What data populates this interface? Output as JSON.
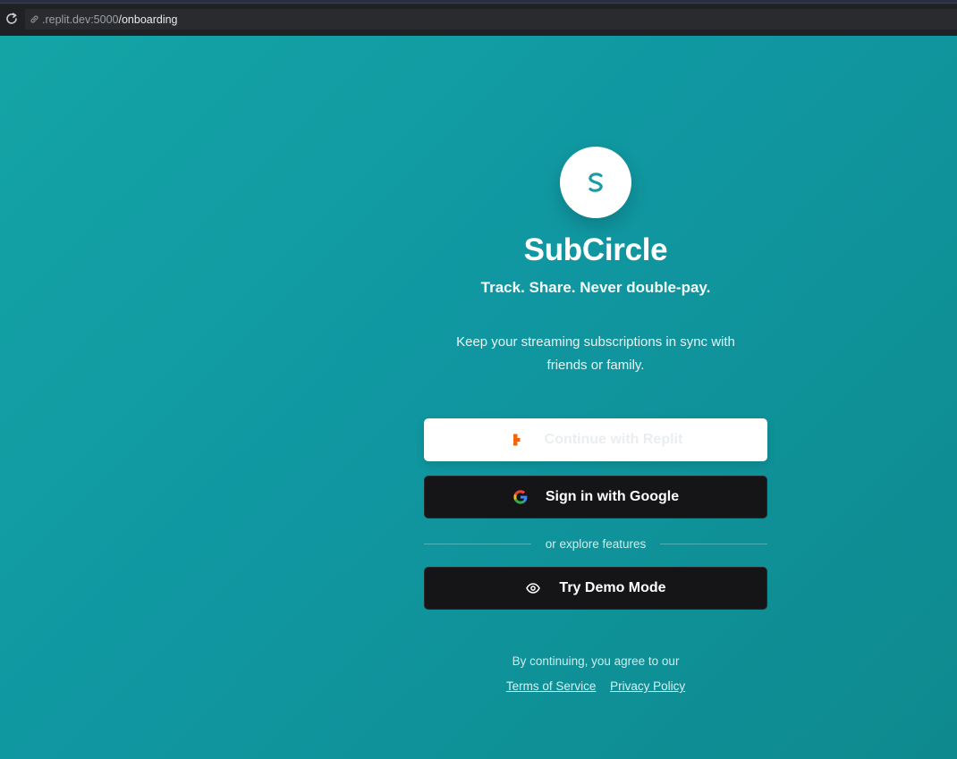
{
  "browser": {
    "url_host": ".replit.dev:5000",
    "url_path": "/onboarding",
    "icons": {
      "reload": "reload-icon",
      "link": "link-icon"
    }
  },
  "app": {
    "name": "SubCircle",
    "logo_letter": "S",
    "tagline": "Track. Share. Never double-pay.",
    "description": "Keep your streaming subscriptions in sync with friends or family."
  },
  "auth": {
    "replit_label": "Continue with Replit",
    "google_label": "Sign in with Google",
    "divider_text": "or explore features",
    "demo_label": "Try Demo Mode"
  },
  "legal": {
    "agree_text": "By continuing, you agree to our",
    "terms_label": "Terms of Service",
    "privacy_label": "Privacy Policy"
  },
  "colors": {
    "background": "#119a9b",
    "primary_dark": "#151518",
    "replit_orange": "#f26207",
    "accent_teal": "#1b9ba6"
  }
}
